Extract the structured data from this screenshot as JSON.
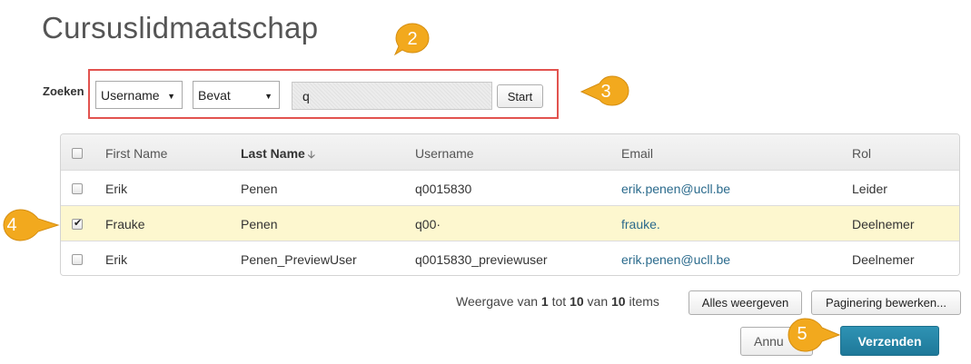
{
  "page": {
    "title": "Cursuslidmaatschap"
  },
  "search": {
    "label": "Zoeken",
    "field_selected": "Username",
    "operator_selected": "Bevat",
    "query_value": "q",
    "start_label": "Start"
  },
  "table": {
    "headers": {
      "first_name": "First Name",
      "last_name": "Last Name",
      "username": "Username",
      "email": "Email",
      "role": "Rol"
    },
    "sorted_column": "Last Name",
    "rows": [
      {
        "checked": false,
        "first_name": "Erik",
        "last_name": "Penen",
        "username": "q0015830",
        "email": "erik.penen@ucll.be",
        "role": "Leider"
      },
      {
        "checked": true,
        "first_name": "Frauke",
        "last_name": "Penen",
        "username": "q00·",
        "email": "frauke.",
        "role": "Deelnemer"
      },
      {
        "checked": false,
        "first_name": "Erik",
        "last_name": "Penen_PreviewUser",
        "username": "q0015830_previewuser",
        "email": "erik.penen@ucll.be",
        "role": "Deelnemer"
      }
    ]
  },
  "pager": {
    "prefix": "Weergave van",
    "from": "1",
    "to_word": "tot",
    "to": "10",
    "of_word": "van",
    "total": "10",
    "suffix": "items",
    "show_all_label": "Alles weergeven",
    "edit_paging_label": "Paginering bewerken..."
  },
  "actions": {
    "cancel_label": "Annu",
    "submit_label": "Verzenden"
  },
  "markers": [
    "2",
    "3",
    "4",
    "5"
  ],
  "colors": {
    "marker": "#f2a91e",
    "highlight": "#e2534f",
    "selected_row": "#fdf7cf",
    "submit": "#2289ab",
    "email_link": "#2a6a8c"
  },
  "icons": {
    "sort": "arrow-down-icon",
    "select": "caret-down-icon",
    "checkbox": "checkmark-icon"
  }
}
